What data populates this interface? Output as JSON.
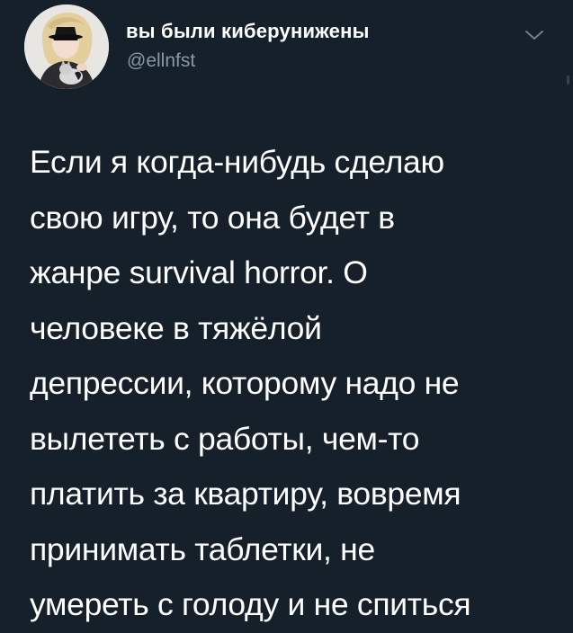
{
  "tweet": {
    "author": {
      "display_name": "вы были киберунижены",
      "handle": "@ellnfst",
      "avatar_icon": "avatar-photo"
    },
    "menu_icon": "chevron-down-icon",
    "text": "Если я когда-нибудь сделаю\nсвою игру, то она будет в\nжанре survival horror. О\nчеловеке в тяжёлой\nдепрессии, которому надо не\nвылететь с работы, чем-то\nплатить за квартиру, вовремя\nпринимать таблетки, не\nумереть с голоду и не спиться"
  },
  "colors": {
    "background": "#15202b",
    "primary_text": "#ffffff",
    "secondary_text": "#8899a6"
  }
}
